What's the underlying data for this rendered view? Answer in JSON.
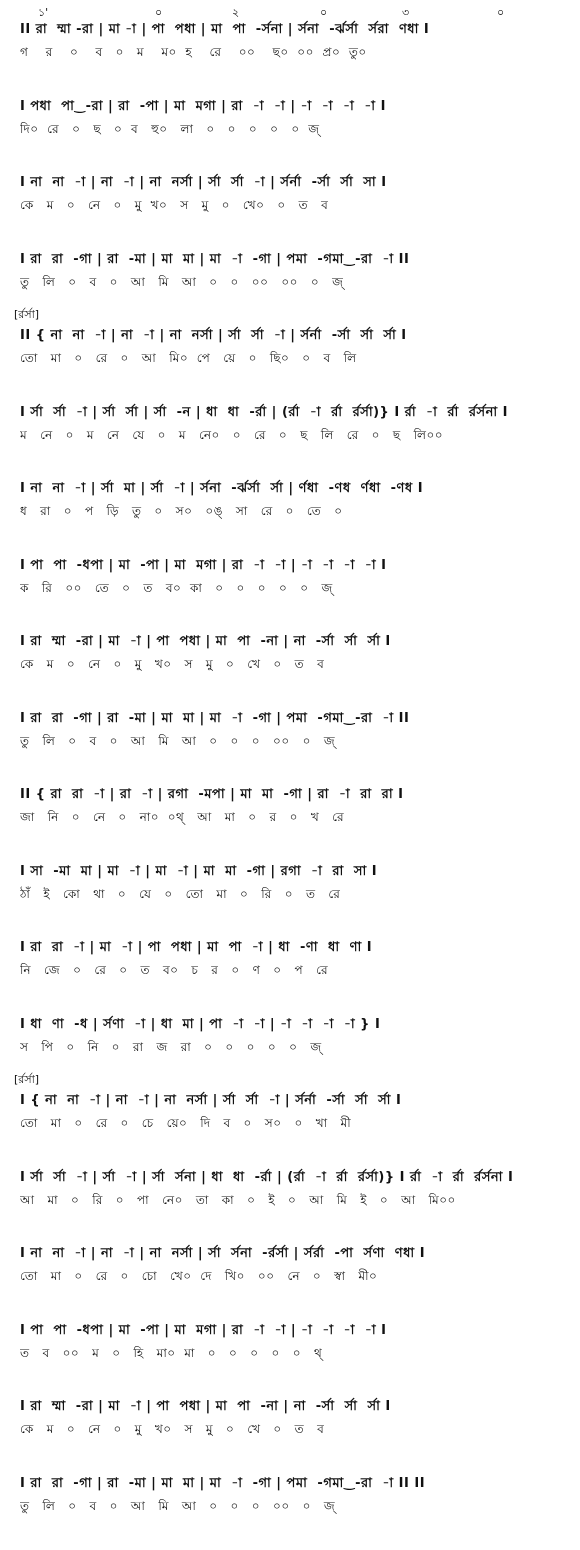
{
  "beat_marks": [
    "১'",
    "০",
    "২",
    "০",
    "৩",
    "০"
  ],
  "rows": [
    {
      "bracket": "",
      "notes": "II রা  ম্মা -রা | মা -া | পা  পধা | মা  পা  -র্সনা | র্সনা  -র্ঝর্সা  র্সরা  ণধা I",
      "lyrics": "গ    র    ০    ব   ০   ম    ম০  হ    রে    ০০    ছ০  ০০  প্র০  তু০"
    },
    {
      "bracket": "",
      "notes": "I পধা  পা‿-রা | রা  -পা | মা  মগা | রা  -া  -া | -া  -া  -া  -া I",
      "lyrics": "দি০  রে   ০   ছ   ০  ব   হু০   লা   ০   ০   ০   ০   ০  জ্"
    },
    {
      "bracket": "",
      "notes": "I না  না  -া | না  -া | না  নর্সা | র্সা  র্সা  -া | র্সর্না  -র্সা  র্সা  সা I",
      "lyrics": "কে   ম   ০   নে   ০   মু  খ০   স   মু   ০   খে০   ০   ত   ব"
    },
    {
      "bracket": "",
      "notes": "I রা  রা  -গা | রা  -মা | মা  মা | মা  -া  -গা | পমা  -গমা‿-রা  -া II",
      "lyrics": "তু   লি   ০   ব   ০   আ   মি   আ   ০   ০   ০০   ০০   ০   জ্"
    },
    {
      "bracket": "[র্রর্সা]",
      "notes": "II { না  না  -া | না  -া | না  নর্সা | র্সা  র্সা  -া | র্সর্না  -র্সা  র্সা  র্সা I",
      "lyrics": "তো   মা   ০   রে   ০   আ   মি০  পে   য়ে   ০   ছি০   ০   ব   লি"
    },
    {
      "bracket": "",
      "notes": "I র্সা  র্সা  -া | র্সা  র্সা | র্সা  -ন | ধা  ধা  -র্রা | (র্রা  -া  র্রা  র্রর্সা)} I র্রা  -া  র্রা  র্রর্সনা I",
      "lyrics": "ম   নে   ০   ম   নে   যে   ০   ম   নে০   ০   রে   ০   ছ   লি   রে   ০   ছ   লি০০"
    },
    {
      "bracket": "",
      "notes": "I না  না  -া | র্সা  মা | র্সা  -া | র্সনা  -র্ঝর্সা  র্সা | র্ণধা  -ণধ  র্ণধা  -ণধ I",
      "lyrics": "ধ   রা   ০   প   ড়ি   তু   ০   স০   ০ঙ্   সা   রে   ০   তে   ০"
    },
    {
      "bracket": "",
      "notes": "I পা  পা  -ধপা | মা  -পা | মা  মগা | রা  -া  -া | -া  -া  -া  -া I",
      "lyrics": "ক   রি   ০০   তে   ০   ত   ব০  কা   ০   ০   ০   ০   ০   জ্"
    },
    {
      "bracket": "",
      "notes": "I রা  ম্মা  -রা | মা  -া | পা  পধা | মা  পা  -না | না  -র্সা  র্সা  র্সা I",
      "lyrics": "কে   ম   ০   নে   ০   মু   খ০   স   মু   ০   খে   ০   ত   ব"
    },
    {
      "bracket": "",
      "notes": "I রা  রা  -গা | রা  -মা | মা  মা | মা  -া  -গা | পমা  -গমা‿-রা  -া II",
      "lyrics": "তু   লি   ০   ব   ০   আ   মি   আ   ০   ০   ০   ০০   ০   জ্"
    },
    {
      "bracket": "",
      "notes": "II { রা  রা  -া | রা  -া | রগা  -মপা | মা  মা  -গা | রা  -া  রা  রা I",
      "lyrics": "জা   নি   ০   নে   ০   না০  ০থ্   আ   মা   ০   র   ০   খ   রে"
    },
    {
      "bracket": "",
      "notes": "I সা  -মা  মা | মা  -া | মা  -া | মা  মা  -গা | রগা  -া  রা  সা I",
      "lyrics": "ঠাঁ   ই   কো   থা   ০   যে   ০   তো   মা   ০   রি   ০   ত   রে"
    },
    {
      "bracket": "",
      "notes": "I রা  রা  -া | মা  -া | পা  পধা | মা  পা  -া | ধা  -ণা  ধা  ণা I",
      "lyrics": "নি   জে   ০   রে   ০   ত   ব০   চ   র   ০   ণ   ০   প   রে"
    },
    {
      "bracket": "",
      "notes": "I ধা  ণা  -ধ | র্সণা  -া | ধা  মা | পা  -া  -া | -া  -া  -া  -া } I",
      "lyrics": "স   পি   ০   নি   ০   রা   জ   রা   ০   ০   ০   ০   ০   জ্"
    },
    {
      "bracket": "[র্রর্সা]",
      "notes": "I { না  না  -া | না  -া | না  নর্সা | র্সা  র্সা  -া | র্সর্না  -র্সা  র্সা  র্সা I",
      "lyrics": "তো   মা   ০   রে   ০   চে   য়ে০   দি   ব   ০   স০   ০   খা   মী"
    },
    {
      "bracket": "",
      "notes": "I র্সা  র্সা  -া | র্সা  -া | র্সা  র্সনা | ধা  ধা  -র্রা | (র্রা  -া  র্রা  র্রর্সা)} I র্রা  -া  র্রা  র্রর্সনা I",
      "lyrics": "আ   মা   ০   রি   ০   পা   নে০   তা   কা   ০   ই   ০   আ   মি   ই   ০   আ   মি০০"
    },
    {
      "bracket": "",
      "notes": "I না  না  -া | না  -া | না  নর্সা | র্সা  র্সনা  -র্রর্সা | র্সর্রা  -পা  র্সণা  ণধা I",
      "lyrics": "তো   মা   ০   রে   ০   চো   খে০  দে   খি০   ০০   নে   ০   স্বা   মী০"
    },
    {
      "bracket": "",
      "notes": "I পা  পা  -ধপা | মা  -পা | মা  মগা | রা  -া  -া | -া  -া  -া  -া I",
      "lyrics": "ত   ব   ০০   ম   ০   হি   মা০  মা   ০   ০   ০   ০   ০   থ্"
    },
    {
      "bracket": "",
      "notes": "I রা  ম্মা  -রা | মা  -া | পা  পধা | মা  পা  -না | না  -র্সা  র্সা  র্সা I",
      "lyrics": "কে   ম   ০   নে   ০   মু   খ০   স   মু   ০   খে   ০   ত   ব"
    },
    {
      "bracket": "",
      "notes": "I রা  রা  -গা | রা  -মা | মা  মা | মা  -া  -গা | পমা  -গমা‿-রা  -া II II",
      "lyrics": "তু   লি   ০   ব   ০   আ   মি   আ   ০   ০   ০   ০০   ০   জ্"
    }
  ]
}
